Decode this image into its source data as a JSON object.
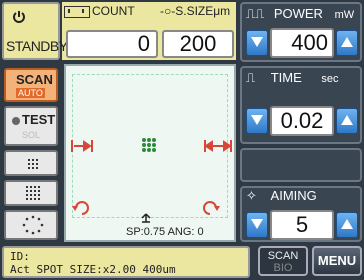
{
  "status": {
    "label": "STANDBY",
    "icon": "power-icon"
  },
  "count": {
    "header": "COUNT",
    "value": "0"
  },
  "spot_size": {
    "header": "S.SIZEμm",
    "value": "200"
  },
  "power": {
    "header": "POWER",
    "unit": "mW",
    "value": "400"
  },
  "time": {
    "header": "TIME",
    "unit": "sec",
    "value": "0.02"
  },
  "aiming": {
    "header": "AIMING",
    "value": "5"
  },
  "left_buttons": {
    "scan": "SCAN",
    "scan_sub": "AUTO",
    "test": "TEST",
    "test_sub": "SOL"
  },
  "preview": {
    "readout": "SP:0.75 ANG:   0"
  },
  "info": {
    "line1": "ID:",
    "line2": "Act SPOT SIZE:x2.00  400um"
  },
  "bottom_buttons": {
    "scan_bio_line1": "SCAN",
    "scan_bio_line2": "BIO",
    "menu": "MENU"
  },
  "colors": {
    "accent_blue": "#2f78c8",
    "panel_yellow": "#ebe6a0",
    "scan_orange": "#e06a2a",
    "pattern_green": "#2c8a3d",
    "marker_red": "#d8463a"
  }
}
